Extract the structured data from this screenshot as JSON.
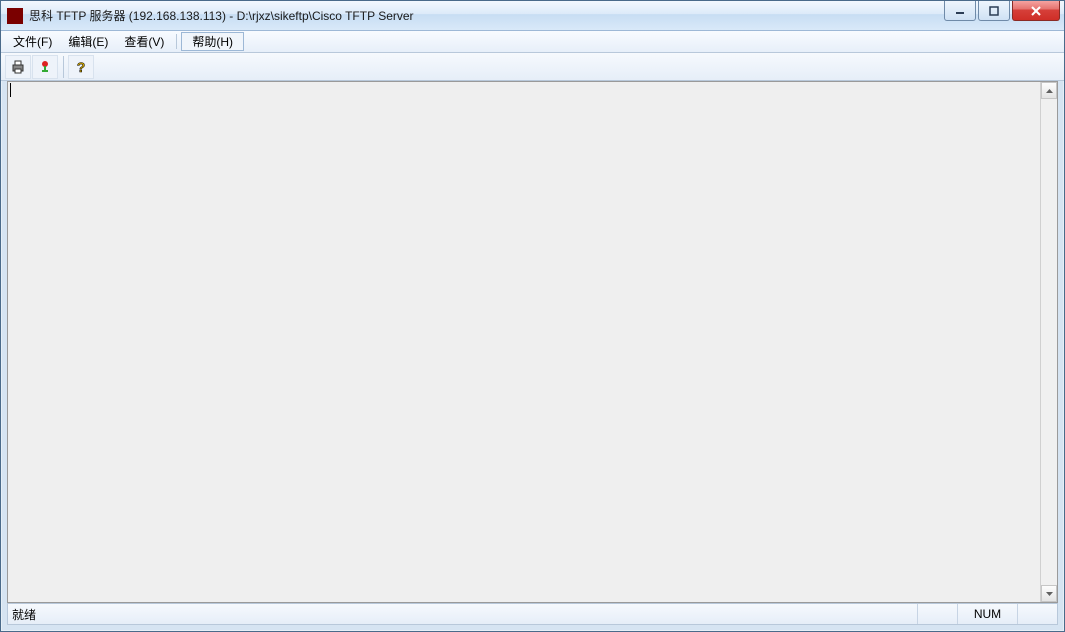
{
  "titlebar": {
    "title": "思科 TFTP 服务器 (192.168.138.113) - D:\\rjxz\\sikeftp\\Cisco TFTP Server"
  },
  "menu": {
    "file": "文件(F)",
    "edit": "编辑(E)",
    "view": "查看(V)",
    "help": "帮助(H)"
  },
  "toolbar": {
    "print_icon": "print-icon",
    "options_icon": "options-icon",
    "help_icon": "help-icon"
  },
  "editor": {
    "content": ""
  },
  "statusbar": {
    "ready": "就绪",
    "num": "NUM"
  }
}
